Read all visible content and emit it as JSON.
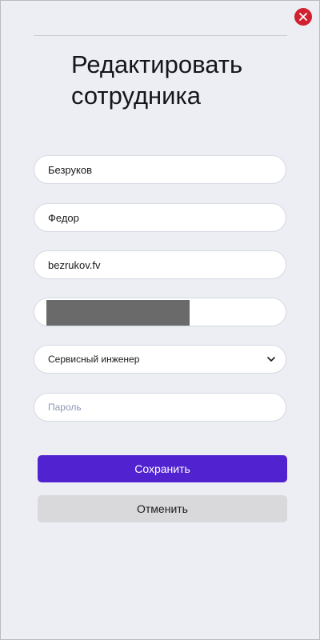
{
  "dialog": {
    "title_line1": "Редактировать",
    "title_line2": "сотрудника",
    "close_icon": "close-icon"
  },
  "form": {
    "last_name": {
      "value": "Безруков",
      "placeholder": ""
    },
    "first_name": {
      "value": "Федор",
      "placeholder": ""
    },
    "login": {
      "value": "bezrukov.fv",
      "placeholder": ""
    },
    "redacted_field": {
      "value": "",
      "placeholder": ""
    },
    "position": {
      "selected": "Сервисный инженер",
      "icon": "chevron-down-icon"
    },
    "password": {
      "value": "",
      "placeholder": "Пароль"
    }
  },
  "actions": {
    "save_label": "Сохранить",
    "cancel_label": "Отменить"
  },
  "colors": {
    "background": "#eceef4",
    "accent": "#5123d0",
    "close": "#d1202f",
    "cancel_bg": "#d9d9dc",
    "placeholder": "#8f97b5"
  }
}
